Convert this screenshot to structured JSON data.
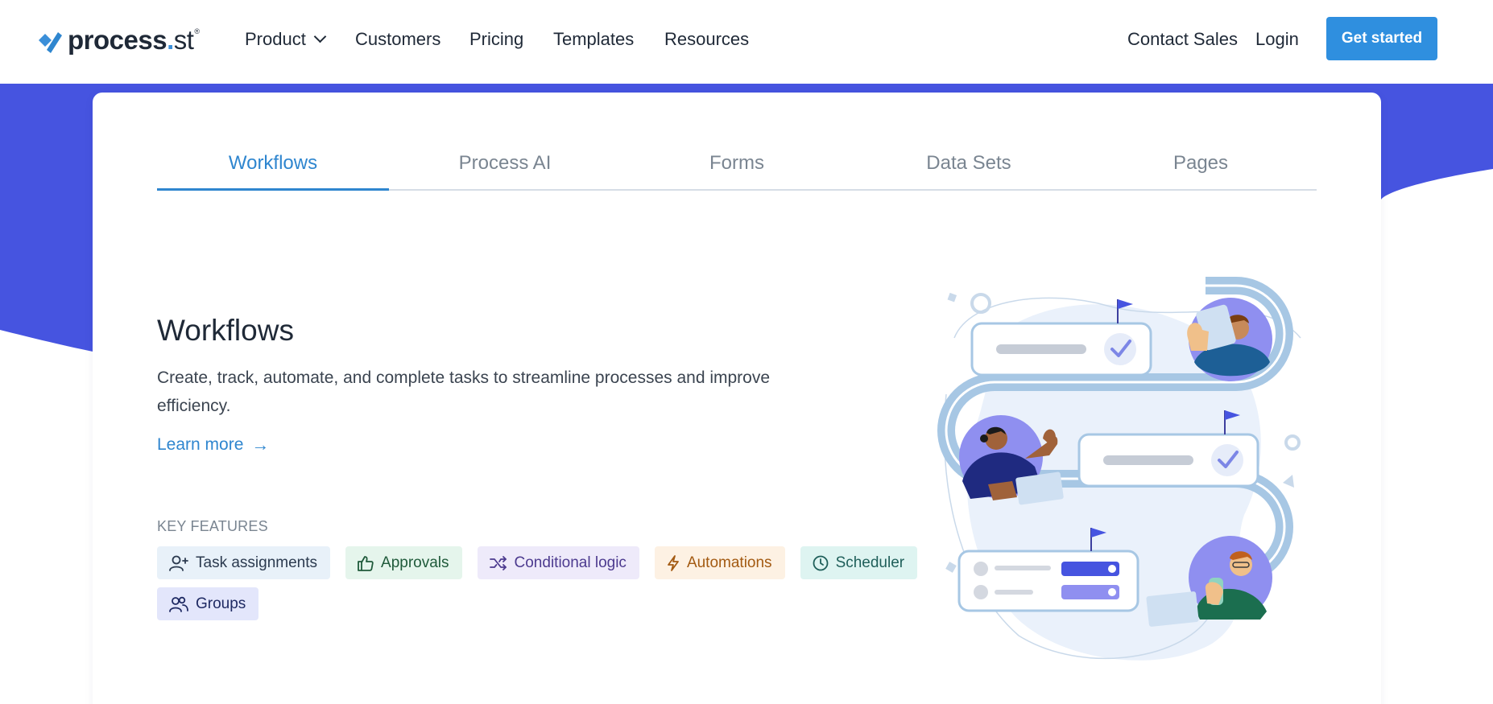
{
  "nav": {
    "logo": {
      "name": "process",
      "dot": ".",
      "suffix": "st",
      "reg": "®"
    },
    "links": [
      "Product",
      "Customers",
      "Pricing",
      "Templates",
      "Resources"
    ],
    "contact_sales": "Contact Sales",
    "login": "Login",
    "cta": "Get started"
  },
  "tabs": [
    "Workflows",
    "Process AI",
    "Forms",
    "Data Sets",
    "Pages"
  ],
  "active_tab": "Workflows",
  "content": {
    "title": "Workflows",
    "description": "Create, track, automate, and complete tasks to streamline processes and improve efficiency.",
    "learn_more": "Learn more",
    "learn_more_arrow": "→",
    "features_heading": "KEY FEATURES",
    "features": [
      {
        "label": "Task assignments",
        "icon": "user-plus-icon",
        "bg": "#e8f1f9",
        "color": "#2b3a4f"
      },
      {
        "label": "Approvals",
        "icon": "thumbs-up-icon",
        "bg": "#e5f5ec",
        "color": "#1f5a3a"
      },
      {
        "label": "Conditional logic",
        "icon": "shuffle-icon",
        "bg": "#eeeafa",
        "color": "#4c3a8f"
      },
      {
        "label": "Automations",
        "icon": "lightning-icon",
        "bg": "#fdf1e3",
        "color": "#a35a12"
      },
      {
        "label": "Scheduler",
        "icon": "clock-icon",
        "bg": "#def4f1",
        "color": "#1f5f5a"
      },
      {
        "label": "Groups",
        "icon": "users-icon",
        "bg": "#e3e6fb",
        "color": "#1f2a63"
      }
    ]
  },
  "colors": {
    "accent": "#2f86cf",
    "cta": "#2f8fdf",
    "wave": "#4654e0"
  }
}
